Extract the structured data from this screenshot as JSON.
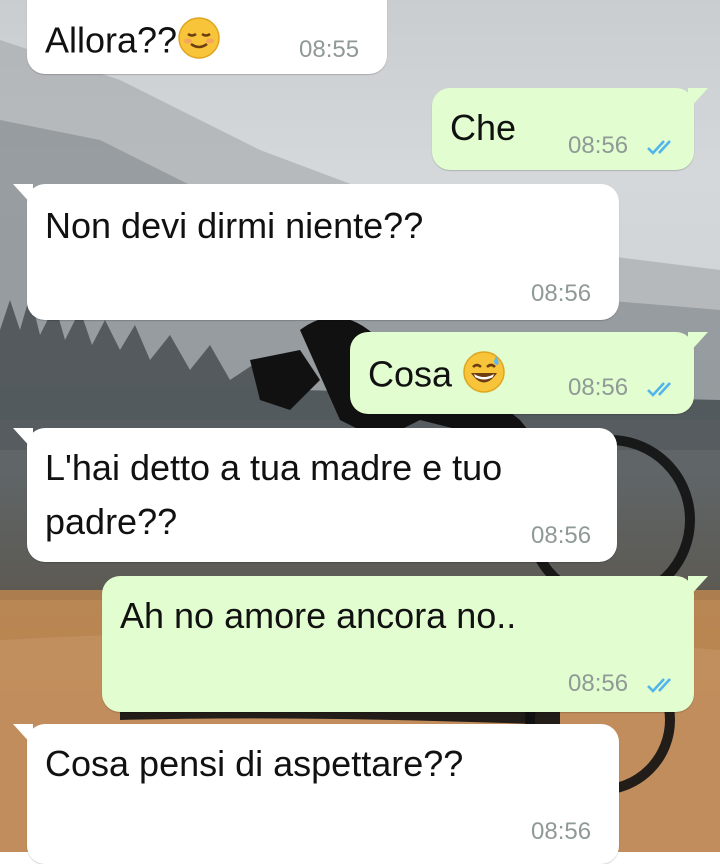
{
  "messages": [
    {
      "id": "m1",
      "direction": "in",
      "text": "Allora??",
      "emoji": "relieved-face",
      "time": "08:55"
    },
    {
      "id": "m2",
      "direction": "out",
      "text": "Che",
      "time": "08:56",
      "status": "read"
    },
    {
      "id": "m3",
      "direction": "in",
      "text": "Non devi dirmi niente??",
      "time": "08:56"
    },
    {
      "id": "m4",
      "direction": "out",
      "text": "Cosa",
      "emoji": "grinning-sweat-face",
      "time": "08:56",
      "status": "read"
    },
    {
      "id": "m5",
      "direction": "in",
      "text_line1": "L'hai detto a tua madre e tuo",
      "text_line2": "padre??",
      "time": "08:56"
    },
    {
      "id": "m6",
      "direction": "out",
      "text": "Ah no amore ancora no..",
      "time": "08:56",
      "status": "read"
    },
    {
      "id": "m7",
      "direction": "in",
      "text": "Cosa pensi di aspettare??",
      "time": "08:56"
    }
  ],
  "colors": {
    "incoming": "#ffffff",
    "outgoing": "#e2fdd0",
    "read_ticks": "#4fb6ec",
    "timestamp": "#8f9a96"
  }
}
